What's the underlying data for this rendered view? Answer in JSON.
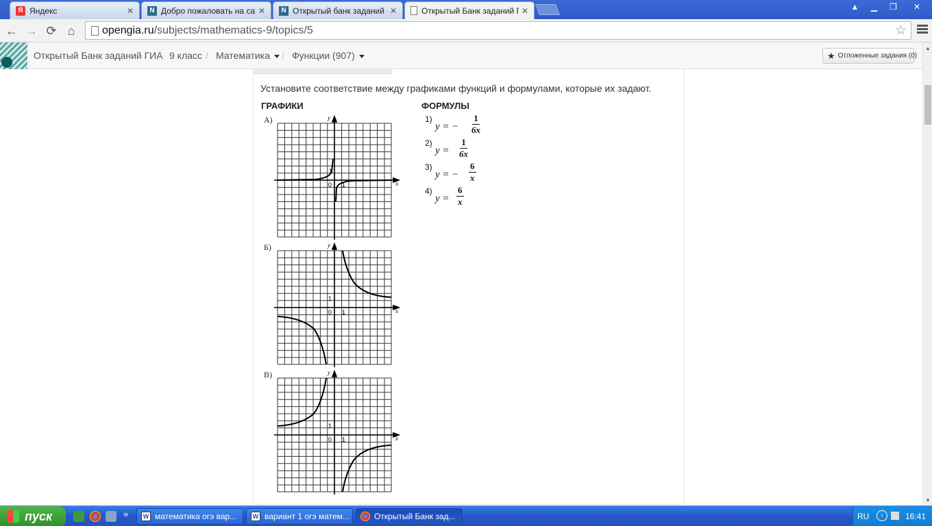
{
  "browser": {
    "tabs": [
      {
        "title": "Яндекс",
        "favicon": "Я"
      },
      {
        "title": "Добро пожаловать на сайт",
        "favicon": "N"
      },
      {
        "title": "Открытый банк заданий О",
        "favicon": "N"
      },
      {
        "title": "Открытый Банк заданий П",
        "favicon": "doc"
      }
    ],
    "url_host": "opengia.ru",
    "url_path": "/subjects/mathematics-9/topics/5"
  },
  "site": {
    "breadcrumbs": [
      "Открытый Банк заданий ГИА",
      "9 класс",
      "Математика",
      "Функции (907)"
    ],
    "deferred_label": "Отложенные задания (0)"
  },
  "task": {
    "question": "Установите соответствие между графиками функций и формулами, которые их задают.",
    "graphs_header": "ГРАФИКИ",
    "formulas_header": "ФОРМУЛЫ",
    "graph_labels": [
      "А)",
      "Б)",
      "В)"
    ],
    "axis": {
      "x": "x",
      "y": "y",
      "zero": "0",
      "one": "1"
    },
    "formulas": [
      {
        "num": "1)",
        "lhs": "y = −",
        "numerator": "1",
        "denominator": "6x"
      },
      {
        "num": "2)",
        "lhs": "y =",
        "numerator": "1",
        "denominator": "6x"
      },
      {
        "num": "3)",
        "lhs": "y = −",
        "numerator": "6",
        "denominator": "x"
      },
      {
        "num": "4)",
        "lhs": "y =",
        "numerator": "6",
        "denominator": "x"
      }
    ]
  },
  "taskbar": {
    "start_label": "пуск",
    "tasks": [
      {
        "title": "математика огэ вар...",
        "icon": "W"
      },
      {
        "title": "вариант 1 огэ матем...",
        "icon": "W"
      },
      {
        "title": "Открытый Банк зад...",
        "icon": "chrome"
      }
    ],
    "lang": "RU",
    "time": "16:41"
  }
}
